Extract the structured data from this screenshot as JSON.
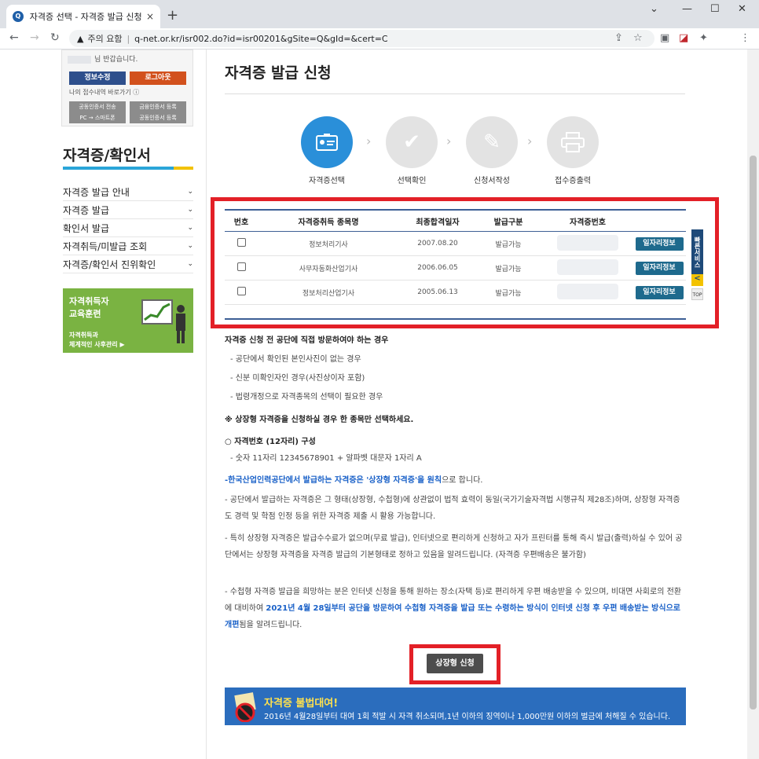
{
  "browser": {
    "tab_title": "자격증 선택 - 자격증 발급 신청",
    "tab_close": "×",
    "new_tab": "+",
    "warning": "주의 요함",
    "url": "q-net.or.kr/isr002.do?id=isr00201&gSite=Q&gId=&cert=C"
  },
  "sidebar": {
    "greeting": "님 반갑습니다.",
    "edit_info": "정보수정",
    "logout": "로그아웃",
    "receipt_link": "나의 접수내역 바로가기",
    "small_buttons": [
      "공동인증서 전송",
      "금융인증서 등록",
      "PC → 스마트폰",
      "공동인증서 등록"
    ],
    "section_title": "자격증/확인서",
    "menu": [
      {
        "label": "자격증 발급 안내"
      },
      {
        "label": "자격증 발급"
      },
      {
        "label": "확인서 발급"
      },
      {
        "label": "자격취득/미발급 조회"
      },
      {
        "label": "자격증/확인서 진위확인"
      }
    ],
    "promo": {
      "line1": "자격취득자",
      "line2": "교육훈련",
      "line3": "자격취득과",
      "line4": "체계적인 사후관리"
    }
  },
  "main": {
    "title": "자격증 발급 신청",
    "steps": [
      {
        "label": "자격증선택",
        "active": true
      },
      {
        "label": "선택확인",
        "active": false
      },
      {
        "label": "신청서작성",
        "active": false
      },
      {
        "label": "접수증출력",
        "active": false
      }
    ],
    "table": {
      "headers": [
        "번호",
        "자격증취득 종목명",
        "최종합격일자",
        "발급구분",
        "자격증번호",
        ""
      ],
      "rows": [
        {
          "name": "정보처리기사",
          "date": "2007.08.20",
          "status": "발급가능",
          "btn": "일자리정보"
        },
        {
          "name": "사무자동화산업기사",
          "date": "2006.06.05",
          "status": "발급가능",
          "btn": "일자리정보"
        },
        {
          "name": "정보처리산업기사",
          "date": "2005.06.13",
          "status": "발급가능",
          "btn": "일자리정보"
        }
      ]
    },
    "quick_service": "빠른서비스",
    "quick_arrow": "<",
    "top": "TOP",
    "notice_title": "자격증 신청 전 공단에 직접 방문하여야 하는 경우",
    "notice_items": [
      "- 공단에서 확인된 본인사진이 없는 경우",
      "- 신분 미확인자인 경우(사진상이자 포함)",
      "- 법령개정으로 자격종목의 선택이 필요한 경우"
    ],
    "select_one": "※ 상장형 자격증을 신청하실 경우 한 종목만 선택하세요.",
    "number_title": "○ 자격번호 (12자리) 구성",
    "number_desc": "- 숫자 11자리 12345678901 + 알파벳 대문자 1자리 A",
    "principle_blue": "-한국산업인력공단에서 발급하는 자격증은 '상장형 자격증'을 원칙",
    "principle_rest": "으로 합니다.",
    "para1": "- 공단에서 발급하는 자격증은 그 형태(상장형, 수첩형)에 상관없이 법적 효력이 동일(국가기술자격법 시행규칙 제28조)하며, 상장형 자격증도 경력 및 학점 인정 등을 위한 자격증 제출 시 활용 가능합니다.",
    "para2": "- 특히 상장형 자격증은 발급수수료가 없으며(무료 발급), 인터넷으로 편리하게 신청하고 자가 프린터를 통해 즉시 발급(출력)하실 수 있어 공단에서는 상장형 자격증을 자격증 발급의 기본형태로 정하고 있음을 알려드립니다. (자격증 우편배송은 불가함)",
    "para3_a": "- 수첩형 자격증 발급을 희망하는 분은 인터넷 신청을 통해 원하는 장소(자택 등)로 편리하게 우편 배송받을 수 있으며, 비대면 사회로의 전환에 대비하여 ",
    "para3_blue": "2021년 4월 28일부터 공단을 방문하여 수첩형 자격증을 발급 또는 수령하는 방식이 인터넷 신청 후 우편 배송받는 방식으로 개편",
    "para3_b": "됨을 알려드립니다.",
    "apply_button": "상장형 신청",
    "banner_title": "자격증 불법대여!",
    "banner_text": "2016년 4월28일부터 대여 1회 적발 시 자격 취소되며,1년 이하의 징역이나 1,000만원 이하의 벌금에 처해질 수 있습니다."
  }
}
